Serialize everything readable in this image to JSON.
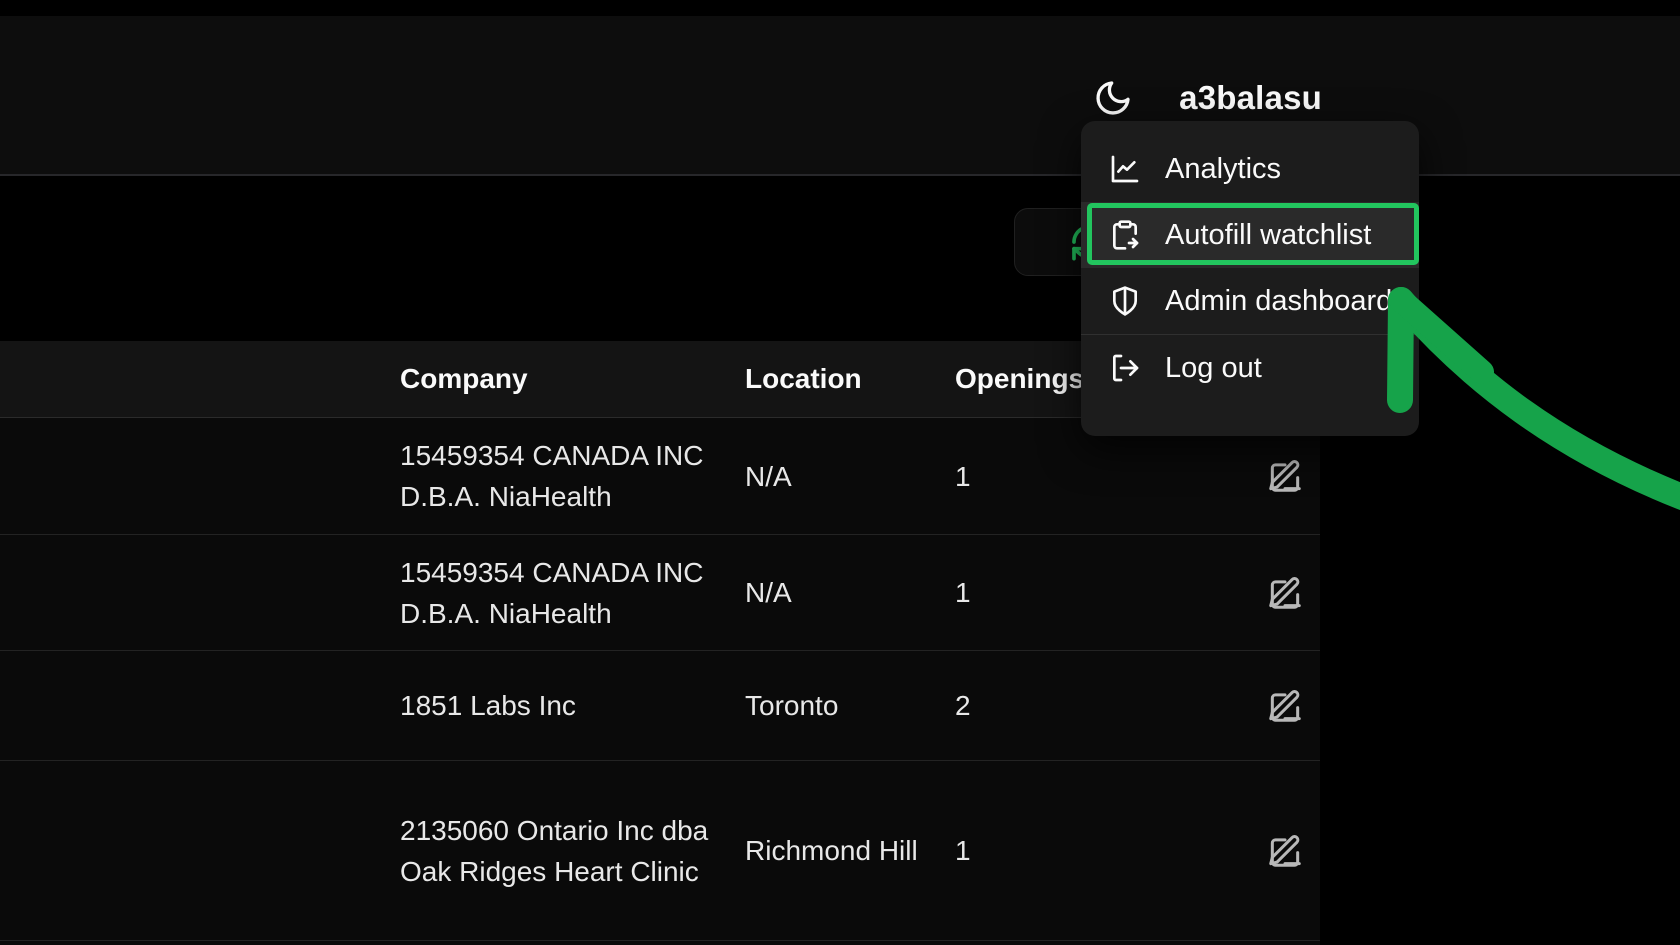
{
  "header": {
    "username": "a3balasu",
    "theme_toggle_icon": "moon-icon"
  },
  "toolbar": {
    "refresh_icon": "refresh-icon",
    "refresh_color": "#22c55e"
  },
  "menu": {
    "items": [
      {
        "label": "Analytics",
        "icon": "chart-line-icon",
        "active": false
      },
      {
        "label": "Autofill watchlist",
        "icon": "clipboard-export-icon",
        "active": true
      },
      {
        "label": "Admin dashboard",
        "icon": "shield-icon",
        "active": false
      },
      {
        "label": "Log out",
        "icon": "log-out-icon",
        "active": false
      }
    ]
  },
  "annotation": {
    "highlight_color": "#22c55e",
    "arrow_color": "#16a34a",
    "target": "Autofill watchlist"
  },
  "table": {
    "columns": [
      "Company",
      "Location",
      "Openings"
    ],
    "rows": [
      {
        "company": "15459354 CANADA INC D.B.A. NiaHealth",
        "location": "N/A",
        "openings": "1",
        "action_icon": "square-pen-icon"
      },
      {
        "company": "15459354 CANADA INC D.B.A. NiaHealth",
        "location": "N/A",
        "openings": "1",
        "action_icon": "square-pen-icon"
      },
      {
        "company": "1851 Labs Inc",
        "location": "Toronto",
        "openings": "2",
        "action_icon": "square-pen-icon"
      },
      {
        "company": "2135060 Ontario Inc dba Oak Ridges Heart Clinic",
        "location": "Richmond Hill",
        "openings": "1",
        "action_icon": "square-pen-icon"
      }
    ]
  }
}
